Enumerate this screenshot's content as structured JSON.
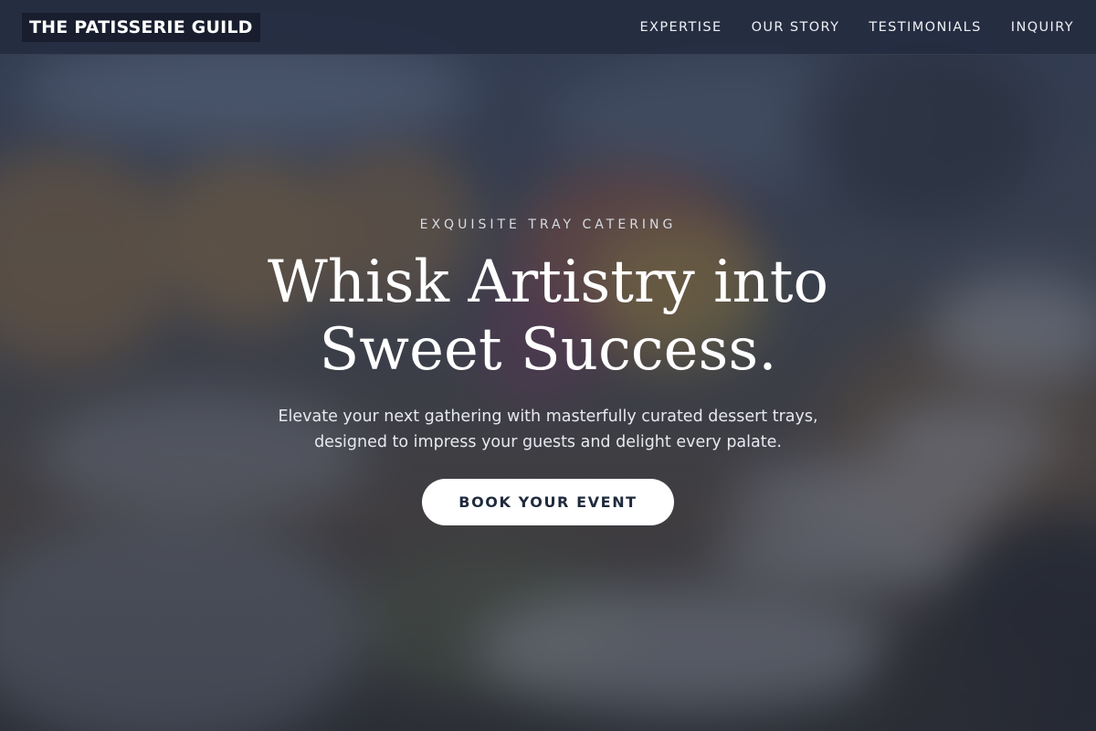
{
  "header": {
    "brand": "THE PATISSERIE GUILD",
    "nav": [
      {
        "label": "EXPERTISE"
      },
      {
        "label": "OUR STORY"
      },
      {
        "label": "TESTIMONIALS"
      },
      {
        "label": "INQUIRY"
      }
    ]
  },
  "hero": {
    "eyebrow": "EXQUISITE TRAY CATERING",
    "headline": "Whisk Artistry into Sweet Success.",
    "subtext": "Elevate your next gathering with masterfully curated dessert trays, designed to impress your guests and delight every palate.",
    "cta_label": "BOOK YOUR EVENT"
  },
  "colors": {
    "header_bg": "#242c40",
    "overlay": "#1e263a",
    "cta_bg": "#ffffff",
    "cta_text": "#1f2a3c"
  }
}
